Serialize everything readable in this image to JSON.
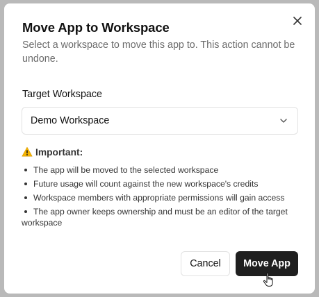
{
  "dialog": {
    "title": "Move App to Workspace",
    "description": "Select a workspace to move this app to. This action cannot be undone.",
    "close_icon": "close-icon"
  },
  "target": {
    "label": "Target Workspace",
    "selected": "Demo Workspace",
    "chevron_icon": "chevron-down-icon"
  },
  "important": {
    "icon": "warning-icon",
    "label": "Important:",
    "items": [
      "The app will be moved to the selected workspace",
      "Future usage will count against the new workspace's credits",
      "Workspace members with appropriate permissions will gain access",
      "The app owner keeps ownership and must be an editor of the target workspace"
    ]
  },
  "actions": {
    "cancel_label": "Cancel",
    "move_label": "Move App"
  },
  "colors": {
    "primary_button": "#1f1f1f",
    "warning": "#f5b400",
    "overlay": "#b9b9b9"
  }
}
